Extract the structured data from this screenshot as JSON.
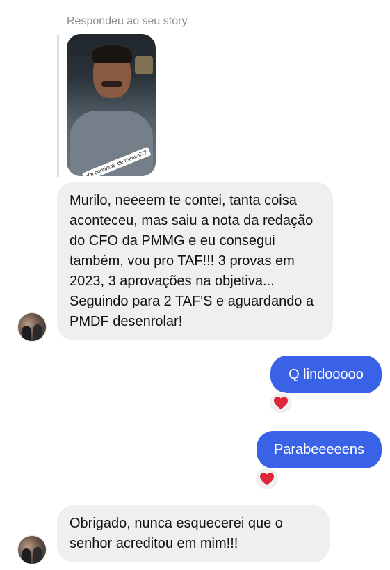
{
  "story_reply": {
    "caption": "Respondeu ao seu story",
    "sticker_text": "Vai continuar de mimimi??"
  },
  "messages": [
    {
      "direction": "incoming",
      "text": "Murilo, neeeem te contei, tanta coisa aconteceu, mas saiu a nota da redação do CFO da PMMG e eu consegui também, vou pro TAF!!! 3 provas em 2023, 3 aprovações na objetiva... Seguindo para 2 TAF'S  e aguardando a PMDF desenrolar!"
    },
    {
      "direction": "outgoing",
      "text": "Q lindooooo",
      "reaction": "heart-icon"
    },
    {
      "direction": "outgoing",
      "text": "Parabeeeeens",
      "reaction": "heart-icon"
    },
    {
      "direction": "incoming",
      "text": "Obrigado, nunca esquecerei que o senhor acreditou em mim!!!"
    }
  ],
  "colors": {
    "outgoing_bubble": "#3a62e6",
    "incoming_bubble": "#efefef",
    "reaction_heart": "#e0243a",
    "caption_text": "#8a8d91"
  }
}
